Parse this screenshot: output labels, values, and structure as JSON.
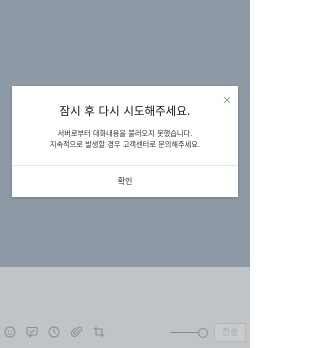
{
  "dialog": {
    "title": "잠시 후 다시 시도해주세요.",
    "message_line1": "서버로부터 대화내용을 불러오지 못했습니다.",
    "message_line2": "지속적으로 발생할 경우 고객센터로 문의해주세요.",
    "confirm_label": "확인",
    "close_icon": "close-icon"
  },
  "toolbar": {
    "icons": [
      "emoji-icon",
      "chat-bubble-icon",
      "clock-icon",
      "attachment-icon",
      "crop-icon"
    ],
    "send_label": "전송",
    "slider_value": 0.85
  },
  "colors": {
    "chat_background": "#8d9aa5",
    "input_background": "#c1c4c7",
    "dialog_background": "#ffffff"
  }
}
